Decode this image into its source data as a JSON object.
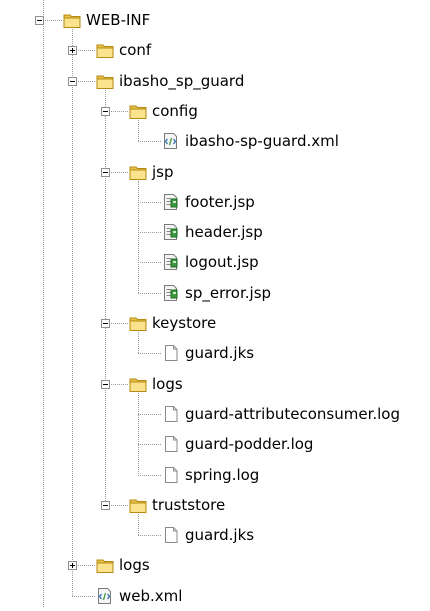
{
  "tree": {
    "nodes": [
      {
        "id": "web-inf",
        "label": "WEB-INF",
        "depth": 0,
        "type": "folder",
        "toggle": "minus"
      },
      {
        "id": "conf",
        "label": "conf",
        "depth": 1,
        "type": "folder",
        "toggle": "plus"
      },
      {
        "id": "ibasho_sp_guard",
        "label": "ibasho_sp_guard",
        "depth": 1,
        "type": "folder",
        "toggle": "minus"
      },
      {
        "id": "config",
        "label": "config",
        "depth": 2,
        "type": "folder",
        "toggle": "minus"
      },
      {
        "id": "ibasho-sp-guard-xml",
        "label": "ibasho-sp-guard.xml",
        "depth": 3,
        "type": "xml-file"
      },
      {
        "id": "jsp",
        "label": "jsp",
        "depth": 2,
        "type": "folder",
        "toggle": "minus"
      },
      {
        "id": "footer-jsp",
        "label": "footer.jsp",
        "depth": 3,
        "type": "jsp-file"
      },
      {
        "id": "header-jsp",
        "label": "header.jsp",
        "depth": 3,
        "type": "jsp-file"
      },
      {
        "id": "logout-jsp",
        "label": "logout.jsp",
        "depth": 3,
        "type": "jsp-file"
      },
      {
        "id": "sp_error-jsp",
        "label": "sp_error.jsp",
        "depth": 3,
        "type": "jsp-file"
      },
      {
        "id": "keystore",
        "label": "keystore",
        "depth": 2,
        "type": "folder",
        "toggle": "minus"
      },
      {
        "id": "keystore-guard-jks",
        "label": "guard.jks",
        "depth": 3,
        "type": "file"
      },
      {
        "id": "logs-inner",
        "label": "logs",
        "depth": 2,
        "type": "folder",
        "toggle": "minus"
      },
      {
        "id": "guard-attributeconsumer-log",
        "label": "guard-attributeconsumer.log",
        "depth": 3,
        "type": "file"
      },
      {
        "id": "guard-podder-log",
        "label": "guard-podder.log",
        "depth": 3,
        "type": "file"
      },
      {
        "id": "spring-log",
        "label": "spring.log",
        "depth": 3,
        "type": "file"
      },
      {
        "id": "truststore",
        "label": "truststore",
        "depth": 2,
        "type": "folder",
        "toggle": "minus"
      },
      {
        "id": "truststore-guard-jks",
        "label": "guard.jks",
        "depth": 3,
        "type": "file"
      },
      {
        "id": "logs-outer",
        "label": "logs",
        "depth": 1,
        "type": "folder",
        "toggle": "plus"
      },
      {
        "id": "web-xml",
        "label": "web.xml",
        "depth": 1,
        "type": "xml-file"
      }
    ]
  }
}
